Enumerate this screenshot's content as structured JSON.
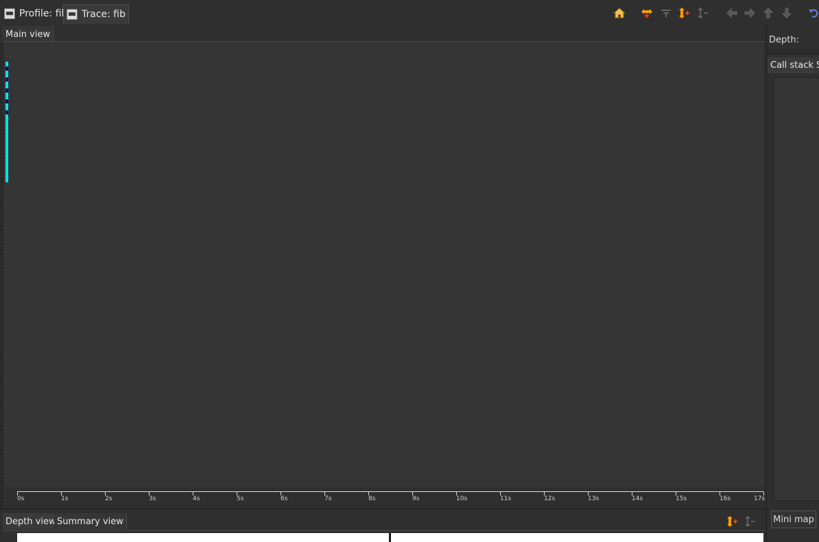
{
  "editor_tabs": [
    {
      "label": "Profile: fib",
      "icon": "hpc-profile-icon"
    },
    {
      "label": "Trace: fib",
      "icon": "hpc-trace-icon"
    }
  ],
  "toolbar": {
    "icons": [
      "home-icon",
      "expand-horizontal-icon",
      "zoom-out-horizontal-icon",
      "expand-vertical-icon",
      "zoom-out-vertical-icon",
      "arrow-left-icon",
      "arrow-right-icon",
      "arrow-up-icon",
      "arrow-down-icon",
      "undo-icon"
    ]
  },
  "main_view": {
    "tab_label": "Main view",
    "time_axis": {
      "ticks": [
        "0s",
        "1s",
        "2s",
        "3s",
        "4s",
        "5s",
        "6s",
        "7s",
        "8s",
        "9s",
        "10s",
        "11s",
        "12s",
        "13s",
        "14s",
        "15s",
        "16s",
        "17s"
      ]
    },
    "trace_colors": {
      "cyan": "#00e5e5",
      "dark_blue": "#101070"
    }
  },
  "right_panel": {
    "depth_label": "Depth:",
    "tabs": [
      "Call stack",
      "S"
    ],
    "mini_map_label": "Mini map"
  },
  "bottom_panel": {
    "tabs": [
      "Depth view",
      "Summary view"
    ]
  },
  "colors": {
    "accent_orange": "#ff9d00",
    "background": "#353535"
  }
}
